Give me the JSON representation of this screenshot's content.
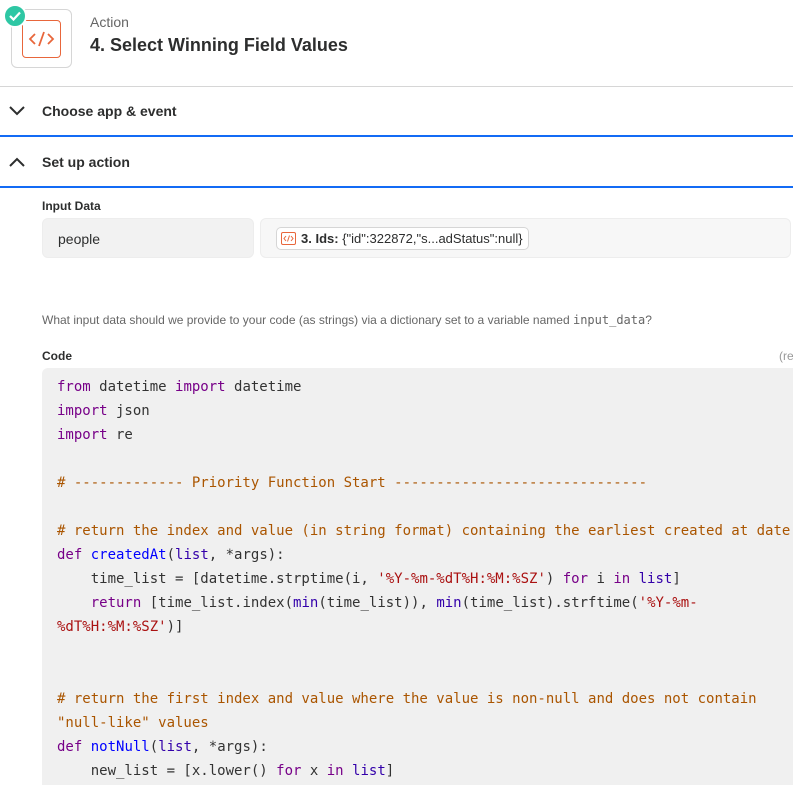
{
  "header": {
    "label": "Action",
    "title": "4. Select Winning Field Values"
  },
  "sections": {
    "choose": "Choose app & event",
    "setup": "Set up action"
  },
  "input_data": {
    "label": "Input Data",
    "key": "people",
    "pill_step": "3. Ids:",
    "pill_value": "{\"id\":322872,\"s...adStatus\":null}",
    "help_prefix": "What input data should we provide to your code (as strings) via a dictionary set to a variable named",
    "help_code": "input_data",
    "help_suffix": "?"
  },
  "code": {
    "label": "Code",
    "required": "(re",
    "lines": [
      [
        [
          "kw",
          "from"
        ],
        [
          "t",
          " datetime "
        ],
        [
          "kw",
          "import"
        ],
        [
          "t",
          " datetime"
        ]
      ],
      [
        [
          "kw",
          "import"
        ],
        [
          "t",
          " json"
        ]
      ],
      [
        [
          "kw",
          "import"
        ],
        [
          "t",
          " re"
        ]
      ],
      [],
      [
        [
          "cm",
          "# ------------- Priority Function Start ------------------------------"
        ]
      ],
      [],
      [
        [
          "cm",
          "# return the index and value (in string format) containing the earliest created at date"
        ]
      ],
      [
        [
          "kw",
          "def"
        ],
        [
          "t",
          " "
        ],
        [
          "fn",
          "createdAt"
        ],
        [
          "t",
          "("
        ],
        [
          "bi",
          "list"
        ],
        [
          "t",
          ", *args):"
        ]
      ],
      [
        [
          "t",
          "    time_list = [datetime.strptime(i, "
        ],
        [
          "st",
          "'%Y-%m-%dT%H:%M:%SZ'"
        ],
        [
          "t",
          ") "
        ],
        [
          "kw",
          "for"
        ],
        [
          "t",
          " i "
        ],
        [
          "kw",
          "in"
        ],
        [
          "t",
          " "
        ],
        [
          "bi",
          "list"
        ],
        [
          "t",
          "]"
        ]
      ],
      [
        [
          "t",
          "    "
        ],
        [
          "kw",
          "return"
        ],
        [
          "t",
          " [time_list.index("
        ],
        [
          "bi",
          "min"
        ],
        [
          "t",
          "(time_list)), "
        ],
        [
          "bi",
          "min"
        ],
        [
          "t",
          "(time_list).strftime("
        ],
        [
          "st",
          "'%Y-%m-"
        ]
      ],
      [
        [
          "st",
          "%dT%H:%M:%SZ'"
        ],
        [
          "t",
          ")]"
        ]
      ],
      [],
      [],
      [
        [
          "cm",
          "# return the first index and value where the value is non-null and does not contain"
        ]
      ],
      [
        [
          "cm",
          "\"null-like\" values"
        ]
      ],
      [
        [
          "kw",
          "def"
        ],
        [
          "t",
          " "
        ],
        [
          "fn",
          "notNull"
        ],
        [
          "t",
          "("
        ],
        [
          "bi",
          "list"
        ],
        [
          "t",
          ", *args):"
        ]
      ],
      [
        [
          "t",
          "    new_list = [x.lower() "
        ],
        [
          "kw",
          "for"
        ],
        [
          "t",
          " x "
        ],
        [
          "kw",
          "in"
        ],
        [
          "t",
          " "
        ],
        [
          "bi",
          "list"
        ],
        [
          "t",
          "]"
        ]
      ]
    ]
  }
}
